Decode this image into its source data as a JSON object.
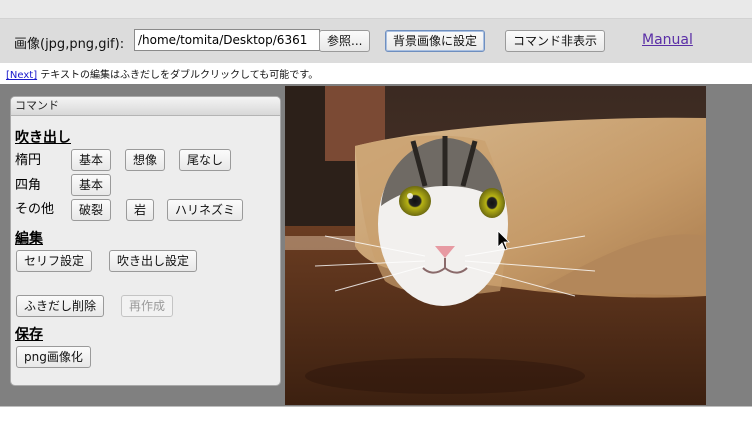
{
  "toolbar": {
    "image_label": "画像(jpg,png,gif):",
    "path_value": "/home/tomita/Desktop/6361",
    "browse_label": "参照...",
    "set_bg_label": "背景画像に設定",
    "hide_cmd_label": "コマンド非表示",
    "manual_label": "Manual"
  },
  "hint": {
    "next_label": "[Next]",
    "text": " テキストの編集はふきだしをダブルクリックしても可能です。"
  },
  "panel": {
    "title": "コマンド",
    "bubble_heading": "吹き出し",
    "ellipse_label": "楕円",
    "ellipse_buttons": [
      "基本",
      "想像",
      "尾なし"
    ],
    "square_label": "四角",
    "square_buttons": [
      "基本"
    ],
    "other_label": "その他",
    "other_buttons": [
      "破裂",
      "岩",
      "ハリネズミ"
    ],
    "edit_heading": "編集",
    "edit_buttons": [
      "セリフ設定",
      "吹き出し設定"
    ],
    "delete_label": "ふきだし削除",
    "regen_label": "再作成",
    "save_heading": "保存",
    "png_label": "png画像化"
  },
  "colors": {
    "link": "#5a2ea6",
    "work_bg": "#808080",
    "panel_bg": "#ededed"
  }
}
